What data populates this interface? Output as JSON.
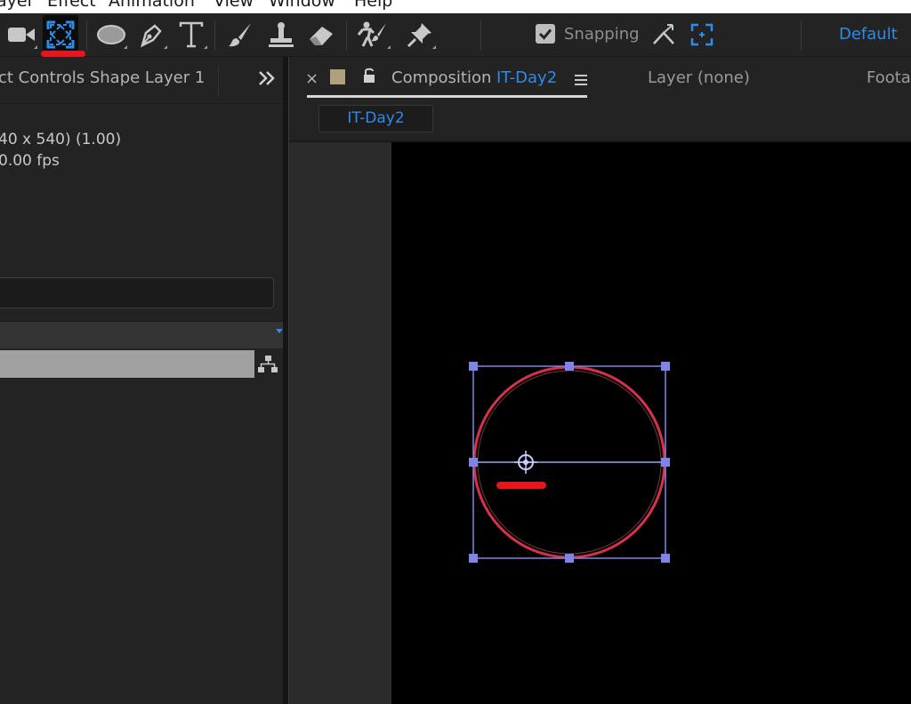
{
  "menu": {
    "items": [
      "ayer",
      "Effect",
      "Animation",
      "View",
      "Window",
      "Help"
    ]
  },
  "toolbar": {
    "tools": [
      {
        "name": "camera-icon"
      },
      {
        "name": "region-of-interest-icon",
        "selected": true
      },
      {
        "name": "ellipse-icon"
      },
      {
        "name": "pen-icon"
      },
      {
        "name": "type-icon"
      },
      {
        "name": "brush-icon"
      },
      {
        "name": "clone-stamp-icon"
      },
      {
        "name": "eraser-icon"
      },
      {
        "name": "puppet-icon"
      },
      {
        "name": "pin-icon"
      }
    ],
    "snapping_label": "Snapping",
    "snapping_checked": true,
    "workspace_label": "Default"
  },
  "left_panel": {
    "tab_label": "ct Controls Shape Layer 1",
    "info_line_1": "40 x 540) (1.00)",
    "info_line_2": "0.00 fps"
  },
  "composition_panel": {
    "close_glyph": "×",
    "tab_word": "Composition",
    "tab_name": "IT-Day2",
    "layer_tab": "Layer  (none)",
    "footage_tab": "Foota",
    "breadcrumb": "IT-Day2"
  },
  "colors": {
    "accent_blue": "#2d8ceb",
    "shape_stroke": "#d8304a",
    "bounding_box": "#7d86e8",
    "annotation_red": "#e8161c",
    "layer_label_color": "#b29f7e"
  }
}
